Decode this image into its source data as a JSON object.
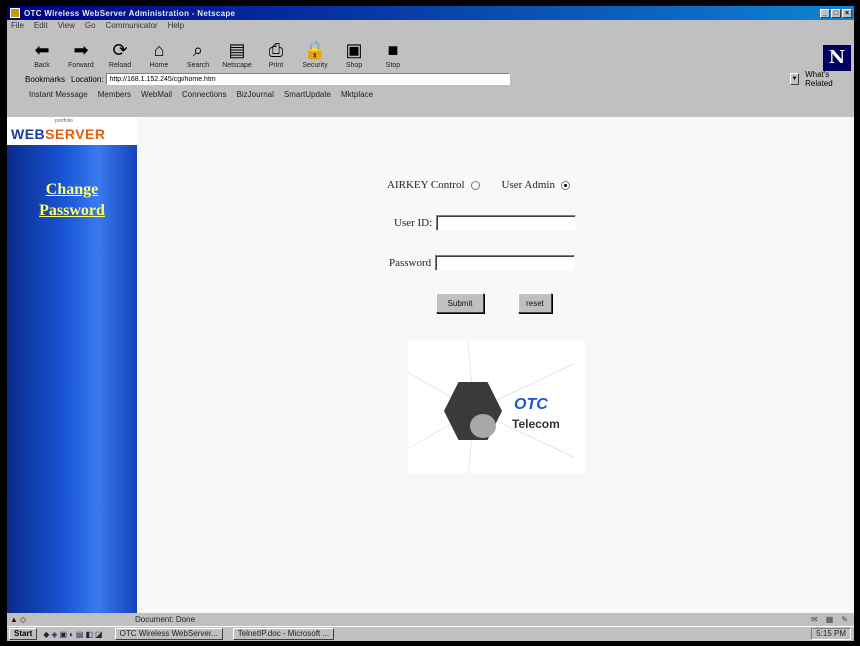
{
  "window": {
    "title": "OTC Wireless WebServer Administration - Netscape"
  },
  "menu": [
    "File",
    "Edit",
    "View",
    "Go",
    "Communicator",
    "Help"
  ],
  "toolbar": [
    {
      "label": "Back",
      "icon": "back-arrow-icon",
      "glyph": "⬅"
    },
    {
      "label": "Forward",
      "icon": "forward-arrow-icon",
      "glyph": "➡"
    },
    {
      "label": "Reload",
      "icon": "reload-icon",
      "glyph": "⟳"
    },
    {
      "label": "Home",
      "icon": "home-icon",
      "glyph": "⌂"
    },
    {
      "label": "Search",
      "icon": "search-icon",
      "glyph": "⌕"
    },
    {
      "label": "Netscape",
      "icon": "netscape-icon",
      "glyph": "▤"
    },
    {
      "label": "Print",
      "icon": "print-icon",
      "glyph": "⎙"
    },
    {
      "label": "Security",
      "icon": "security-icon",
      "glyph": "🔒"
    },
    {
      "label": "Shop",
      "icon": "shop-icon",
      "glyph": "▣"
    },
    {
      "label": "Stop",
      "icon": "stop-icon",
      "glyph": "■"
    }
  ],
  "location": {
    "bookmarks_label": "Bookmarks",
    "location_label": "Location:",
    "url": "http://168.1.152.245/cgi/home.htm",
    "whats_related": "What's Related"
  },
  "personal_toolbar": [
    "Instant Message",
    "Members",
    "WebMail",
    "Connections",
    "BizJournal",
    "SmartUpdate",
    "Mktplace"
  ],
  "sidebar": {
    "logo_small": "portfolio",
    "logo_part1": "WEB",
    "logo_part2": "SERVER",
    "link_line1": "Change",
    "link_line2": "Password"
  },
  "form": {
    "radio1_label": "AIRKEY Control",
    "radio2_label": "User Admin",
    "radio1_checked": false,
    "radio2_checked": true,
    "userid_label": "User ID:",
    "userid_value": "",
    "password_label": "Password",
    "password_value": "",
    "submit_label": "Submit",
    "reset_label": "reset"
  },
  "brand": {
    "line1": "OTC",
    "line2": "Telecom"
  },
  "status": {
    "text": "Document: Done"
  },
  "taskbar": {
    "start": "Start",
    "task1": "OTC Wireless WebServer...",
    "task2": "TelnetIP.doc - Microsoft ...",
    "clock": "5:15 PM"
  },
  "colors": {
    "sidebar_top": "#0a2a8a",
    "sidebar_mid": "#3a7af0",
    "link": "#ffff66",
    "brand_blue": "#1a56d6"
  }
}
